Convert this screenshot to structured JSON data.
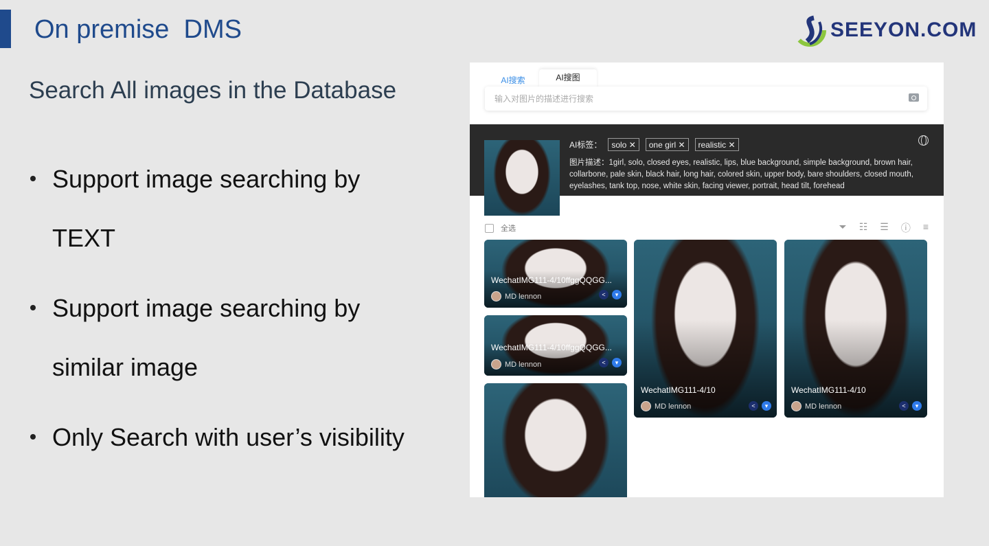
{
  "slide": {
    "title": "On premise  DMS",
    "subtitle": "Search All images in the Database",
    "bullets": [
      "Support image searching by TEXT",
      "Support image searching by similar image",
      "Only Search with user’s visibility"
    ],
    "logo": "SEEYON.COM"
  },
  "app": {
    "tabs": [
      {
        "label": "AI搜索",
        "active": false
      },
      {
        "label": "AI搜图",
        "active": true
      }
    ],
    "search": {
      "placeholder": "输入对图片的描述进行搜索",
      "icon": "camera-icon"
    },
    "ai_tags_label": "AI标签：",
    "tags": [
      "solo",
      "one girl",
      "realistic"
    ],
    "description_label": "图片描述：",
    "description": "1girl, solo, closed eyes, realistic, lips, blue background, simple background, brown hair, collarbone, pale skin, black hair, long hair, colored skin, upper body, bare shoulders, closed mouth, eyelashes, tank top, nose, white skin, facing viewer, portrait, head tilt, forehead",
    "select_all": "全选",
    "toolbar_icons": [
      "filter-icon",
      "grid-list-icon",
      "list-icon",
      "info-icon",
      "sort-icon"
    ],
    "cards": [
      {
        "name": "WechatIMG111-4/10ffggQQGG...",
        "owner": "MD lennon"
      },
      {
        "name": "WechatIMG111-4/10ffggQQGG...",
        "owner": "MD lennon"
      },
      {
        "name": "WechatIMG111-4/10",
        "owner": "MD lennon"
      },
      {
        "name": "WechatIMG111-4/10",
        "owner": "MD lennon"
      }
    ],
    "colors": {
      "accent": "#3a8ee6",
      "dark_band": "#2a2a2a",
      "title": "#1f4a8c"
    }
  }
}
